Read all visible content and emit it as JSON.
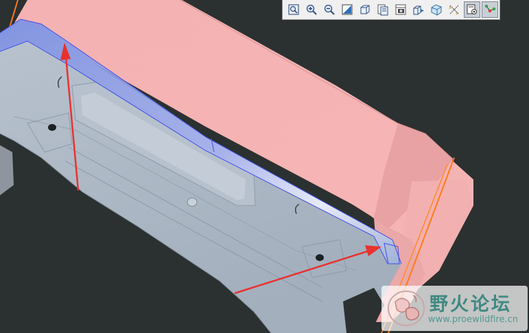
{
  "app": {
    "window_kind": "3D CAD model viewport",
    "colors": {
      "background": "#2b3130",
      "part_gray": "#a9b4c1",
      "part_pink": "#f3b0b0",
      "highlight_blue": "#8a98e6",
      "edge_orange": "#ff7a1a",
      "arrow_red": "#e8322d"
    }
  },
  "toolbar": {
    "buttons": [
      {
        "name": "zoom-fit",
        "icon": "zoom-fit-icon",
        "pressed": false
      },
      {
        "name": "zoom-in",
        "icon": "zoom-in-icon",
        "pressed": false
      },
      {
        "name": "zoom-out",
        "icon": "zoom-out-icon",
        "pressed": false
      },
      {
        "name": "repaint",
        "icon": "repaint-icon",
        "pressed": false
      },
      {
        "name": "orient",
        "icon": "orient-icon",
        "pressed": false
      },
      {
        "name": "saved-views",
        "icon": "saved-views-icon",
        "pressed": false
      },
      {
        "name": "display-style",
        "icon": "display-style-icon",
        "pressed": false
      },
      {
        "name": "view-manager",
        "icon": "view-manager-icon",
        "pressed": false
      },
      {
        "name": "perspective",
        "icon": "perspective-icon",
        "pressed": false
      },
      {
        "name": "datum-display",
        "icon": "datum-display-icon",
        "pressed": false
      },
      {
        "name": "annotation-display",
        "icon": "annotation-display-icon",
        "pressed": true
      },
      {
        "name": "spin-center",
        "icon": "spin-center-icon",
        "pressed": true
      }
    ]
  },
  "watermark": {
    "title": "野火论坛",
    "url": "www.proewildfire.cn"
  }
}
